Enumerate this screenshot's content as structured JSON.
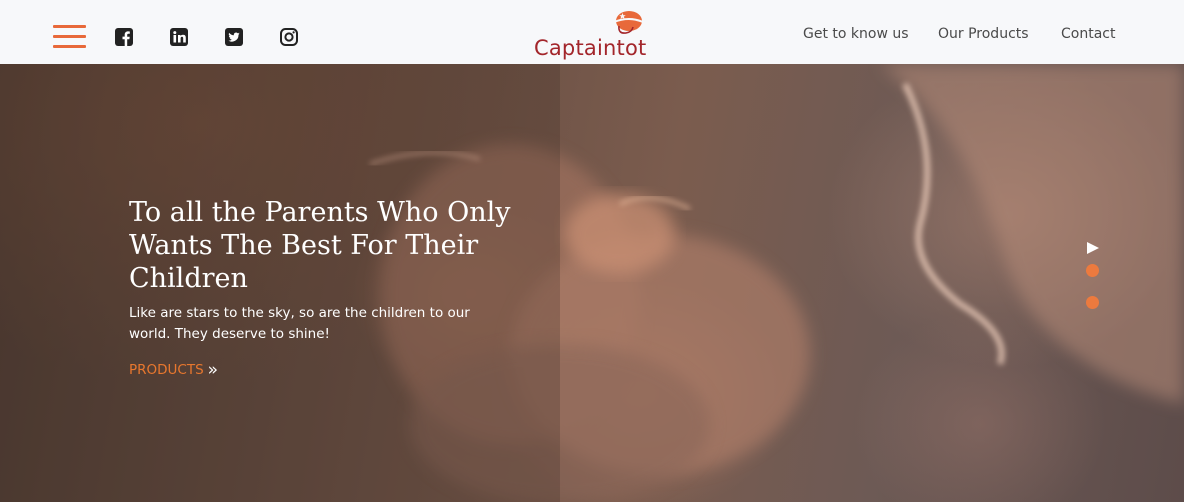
{
  "header": {
    "social": [
      {
        "name": "facebook-icon"
      },
      {
        "name": "linkedin-icon"
      },
      {
        "name": "twitter-icon"
      },
      {
        "name": "instagram-icon"
      }
    ],
    "logo_text": "Captaintot",
    "nav": [
      "Get to know us",
      "Our Products",
      "Contact"
    ]
  },
  "hero": {
    "title": "To all the Parents Who Only Wants The Best For Their Children",
    "subtitle": "Like are stars to the sky, so are the children to our world. They deserve to shine!",
    "cta_label": "PRODUCTS",
    "cta_icon": "»"
  },
  "colors": {
    "accent": "#e8693a",
    "brand": "#a3262b",
    "header_bg": "#f7f8fa"
  }
}
